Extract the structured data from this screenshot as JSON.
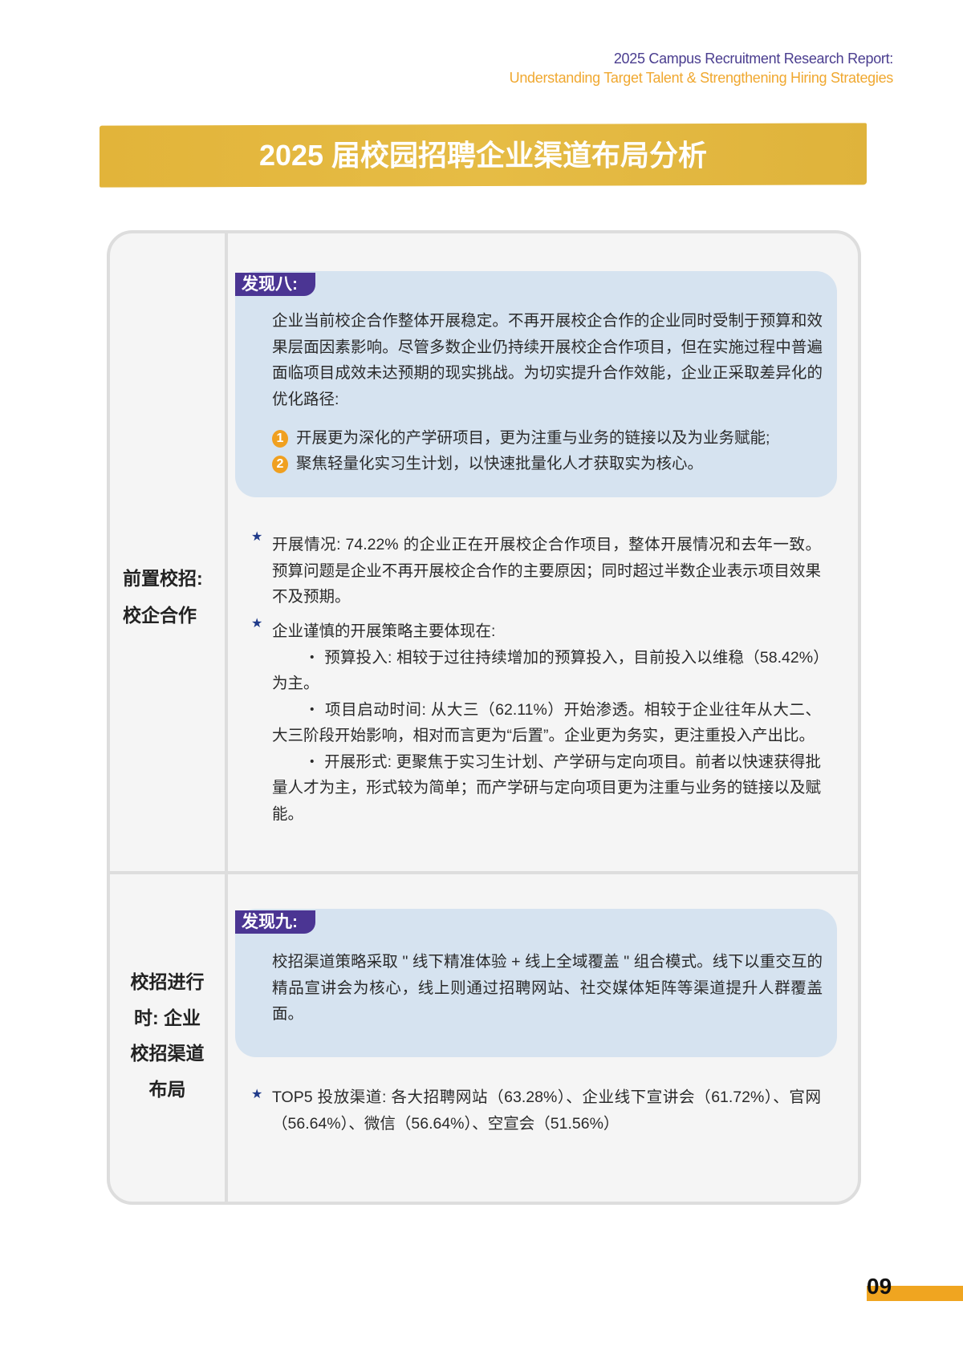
{
  "header": {
    "line1": "2025 Campus Recruitment Research Report:",
    "line2": "Understanding Target Talent & Strengthening Hiring Strategies"
  },
  "title": "2025 届校园招聘企业渠道布局分析",
  "section1": {
    "label_lines": [
      "前置校招:",
      "校企合作"
    ],
    "finding": {
      "tag": "发现八:",
      "text": "企业当前校企合作整体开展稳定。不再开展校企合作的企业同时受制于预算和效果层面因素影响。尽管多数企业仍持续开展校企合作项目，但在实施过程中普遍面临项目成效未达预期的现实挑战。为切实提升合作效能，企业正采取差异化的优化路径:",
      "items": [
        {
          "num": "1",
          "text": "开展更为深化的产学研项目，更为注重与业务的链接以及为业务赋能;"
        },
        {
          "num": "2",
          "text": "聚焦轻量化实习生计划，以快速批量化人才获取实为核心。"
        }
      ]
    },
    "bullets": [
      {
        "icon": "star",
        "text": "开展情况: 74.22% 的企业正在开展校企合作项目，整体开展情况和去年一致。预算问题是企业不再开展校企合作的主要原因；同时超过半数企业表示项目效果不及预期。"
      },
      {
        "icon": "star",
        "text": "企业谨慎的开展策略主要体现在:",
        "subs": [
          "・ 预算投入: 相较于过往持续增加的预算投入，目前投入以维稳（58.42%）为主。",
          "・ 项目启动时间: 从大三（62.11%）开始渗透。相较于企业往年从大二、大三阶段开始影响，相对而言更为“后置”。企业更为务实，更注重投入产出比。",
          "・  开展形式: 更聚焦于实习生计划、产学研与定向项目。前者以快速获得批量人才为主，形式较为简单；而产学研与定向项目更为注重与业务的链接以及赋能。"
        ]
      }
    ]
  },
  "section2": {
    "label_lines": [
      "校招进行",
      "时: 企业",
      "校招渠道",
      "布局"
    ],
    "finding": {
      "tag": "发现九:",
      "text": "校招渠道策略采取 \" 线下精准体验 + 线上全域覆盖 \" 组合模式。线下以重交互的精品宣讲会为核心，线上则通过招聘网站、社交媒体矩阵等渠道提升人群覆盖面。"
    },
    "bullets": [
      {
        "icon": "star",
        "text": "TOP5 投放渠道: 各大招聘网站（63.28%）、企业线下宣讲会（61.72%）、官网（56.64%）、微信（56.64%）、空宣会（51.56%）"
      }
    ]
  },
  "page_number": "09",
  "colors": {
    "purple": "#4b3593",
    "orange": "#f0a520",
    "gold": "#e2b43a",
    "box": "#d6e3f0",
    "star": "#1f3a8a"
  }
}
